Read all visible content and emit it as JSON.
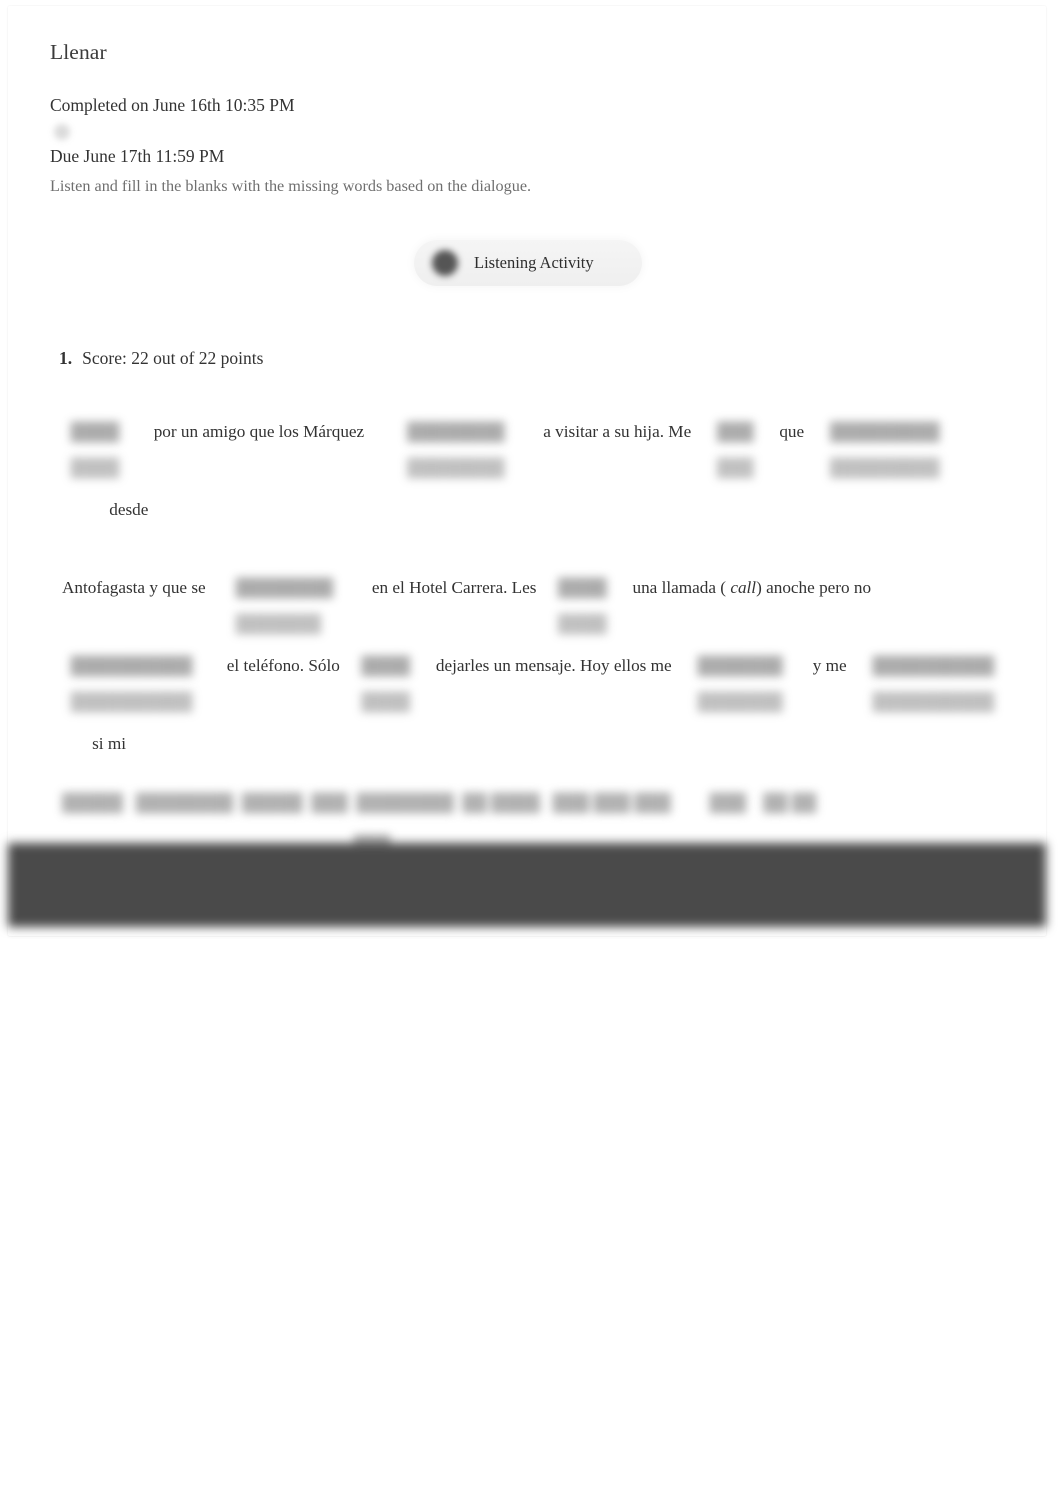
{
  "assignment": {
    "title": "Llenar",
    "completed_label": "Completed on June 16th 10:35 PM",
    "due_label": "Due June 17th 11:59 PM",
    "instructions": "Listen and fill in the blanks with the missing words based on the dialogue."
  },
  "player": {
    "label": "Listening Activity",
    "play_icon": "play-circle-icon"
  },
  "question": {
    "number": "1.",
    "score_text": "Score: 22 out of 22 points",
    "points_earned": 22,
    "points_total": 22,
    "highlight_color": "#cfe5d5"
  },
  "exercise": {
    "lines": [
      {
        "parts": [
          {
            "type": "blank",
            "answer": "████",
            "feedback": "████",
            "pad_before": "  ",
            "pad_after": "        "
          },
          {
            "type": "text",
            "text": "por un amigo que los Márquez"
          },
          {
            "type": "blank",
            "answer": "████████",
            "feedback": "████████",
            "pad_before": "          ",
            "pad_after": "         "
          },
          {
            "type": "text",
            "text": "a visitar a su hija. Me"
          },
          {
            "type": "blank",
            "answer": "███",
            "feedback": "███",
            "pad_before": "      ",
            "pad_after": "      "
          },
          {
            "type": "text",
            "text": "que"
          },
          {
            "type": "blank",
            "answer": "█████████",
            "feedback": "█████████",
            "pad_before": "      ",
            "pad_after": "           "
          },
          {
            "type": "text",
            "text": "desde"
          }
        ]
      },
      {
        "parts": [
          {
            "type": "text",
            "text": "Antofagasta y que se"
          },
          {
            "type": "blank",
            "answer": "████████",
            "feedback": "███████",
            "pad_before": "       ",
            "pad_after": "         "
          },
          {
            "type": "text",
            "text": "en el Hotel Carrera. Les"
          },
          {
            "type": "blank",
            "answer": "████",
            "feedback": "████",
            "pad_before": "     ",
            "pad_after": "      "
          },
          {
            "type": "text",
            "text": "una llamada ("
          },
          {
            "type": "italic",
            "text": " call"
          },
          {
            "type": "text",
            "text": ") anoche pero no"
          }
        ]
      },
      {
        "parts": [
          {
            "type": "blank",
            "answer": "██████████",
            "feedback": "██████████",
            "pad_before": "  ",
            "pad_after": "        "
          },
          {
            "type": "text",
            "text": "el teléfono. Sólo"
          },
          {
            "type": "blank",
            "answer": "████",
            "feedback": "████",
            "pad_before": "     ",
            "pad_after": "      "
          },
          {
            "type": "text",
            "text": "dejarles un mensaje. Hoy ellos me"
          },
          {
            "type": "blank",
            "answer": "███████",
            "feedback": "███████",
            "pad_before": "      ",
            "pad_after": "       "
          },
          {
            "type": "text",
            "text": "y me"
          },
          {
            "type": "blank",
            "answer": "██████████",
            "feedback": "██████████",
            "pad_before": "      ",
            "pad_after": "       "
          },
          {
            "type": "text",
            "text": "si mi"
          }
        ]
      }
    ],
    "obscured_line": "█████   ████████  █████  ███  ████████  ██ ████.  ███ ███ ███         ███    ██ ██",
    "obscured_line_2": "███"
  }
}
